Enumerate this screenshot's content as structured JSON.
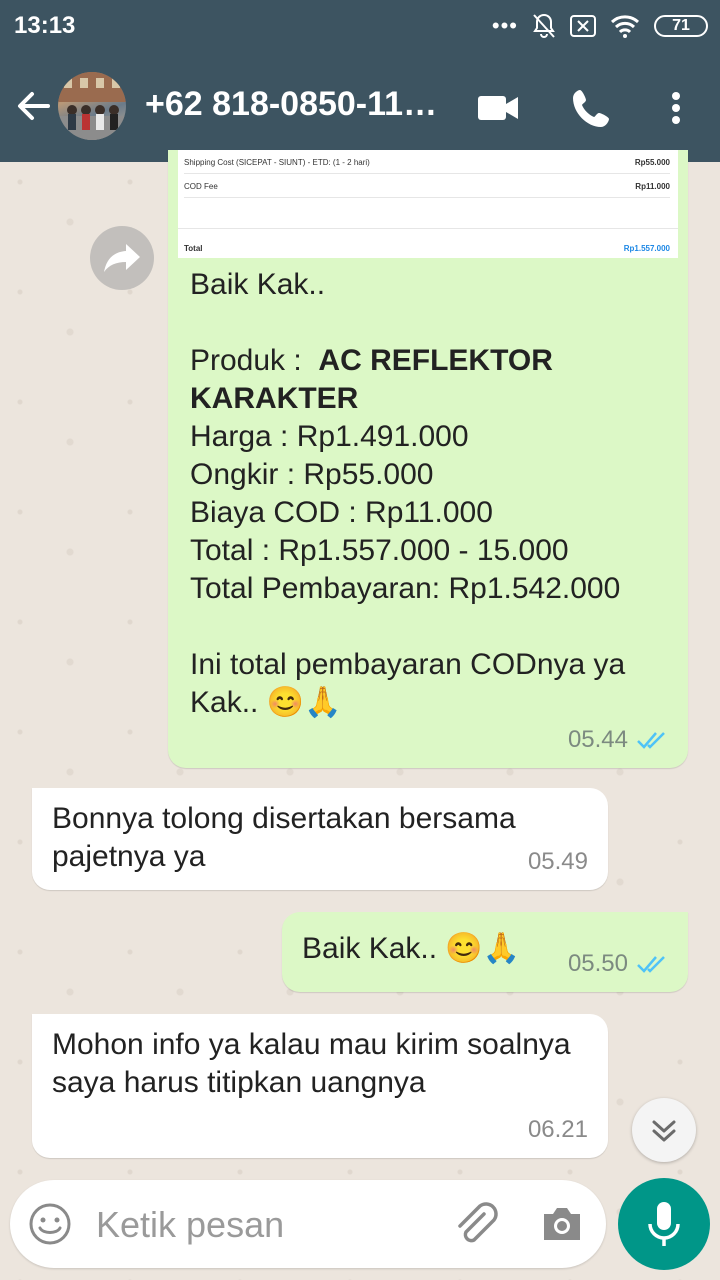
{
  "status_bar": {
    "time": "13:13",
    "battery": "71"
  },
  "header": {
    "contact": "+62 818-0850-11…"
  },
  "receipt_image": {
    "rows": [
      {
        "label": "Shipping Cost (SICEPAT - SIUNT) - ETD: (1 - 2 hari)",
        "value": "Rp55.000"
      },
      {
        "label": "COD Fee",
        "value": "Rp11.000"
      }
    ],
    "total_label": "Total",
    "total_value": "Rp1.557.000"
  },
  "messages": [
    {
      "direction": "out",
      "intro": "Baik Kak..",
      "product_prefix": "Produk :  ",
      "product_name": "AC REFLEKTOR KARAKTER",
      "lines": [
        "Harga : Rp1.491.000",
        "Ongkir : Rp55.000",
        "Biaya COD : Rp11.000",
        "Total : Rp1.557.000 - 15.000",
        "Total Pembayaran: Rp1.542.000"
      ],
      "closing": "Ini total pembayaran CODnya ya Kak.. 😊🙏",
      "time": "05.44"
    },
    {
      "direction": "in",
      "text": "Bonnya tolong disertakan bersama pajetnya ya",
      "time": "05.49"
    },
    {
      "direction": "out",
      "text": "Baik Kak.. 😊🙏",
      "time": "05.50"
    },
    {
      "direction": "in",
      "text": "Mohon info ya kalau mau kirim soalnya saya harus titipkan uangnya",
      "time": "06.21"
    }
  ],
  "input": {
    "placeholder": "Ketik pesan"
  },
  "icons": {
    "back": "arrow-left-icon",
    "video": "video-call-icon",
    "call": "phone-icon",
    "menu": "more-vert-icon",
    "forward": "forward-icon",
    "read": "double-check-icon",
    "emoji": "emoji-icon",
    "attach": "paperclip-icon",
    "camera": "camera-icon",
    "mic": "microphone-icon",
    "scroll": "chevron-double-down-icon"
  },
  "colors": {
    "header": "#3d5461",
    "outgoing": "#dcf8c6",
    "incoming": "#ffffff",
    "tick": "#4fc3f7",
    "mic": "#009688"
  }
}
